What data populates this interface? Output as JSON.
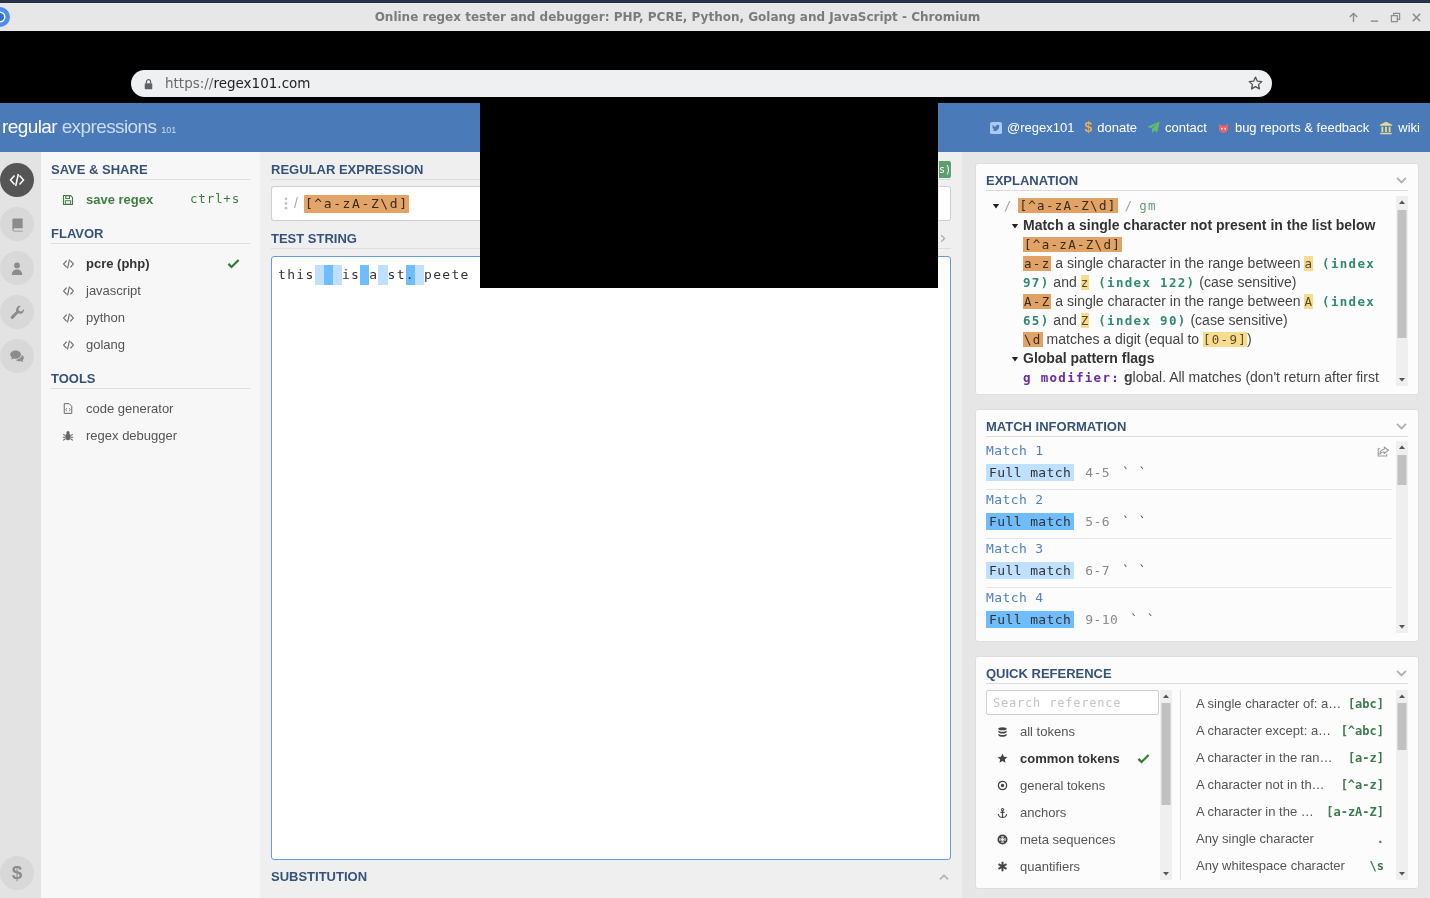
{
  "browser": {
    "title": "Online regex tester and debugger: PHP, PCRE, Python, Golang and JavaScript - Chromium",
    "address": {
      "scheme": "https://",
      "host": "regex101.com"
    }
  },
  "header": {
    "logo": {
      "main": "regular",
      "secondary": "expressions",
      "version": "101"
    },
    "links": [
      {
        "kind": "social",
        "label": "@regex101"
      },
      {
        "kind": "donate",
        "symbol": "$",
        "label": "donate"
      },
      {
        "kind": "contact",
        "label": "contact"
      },
      {
        "kind": "issues",
        "label": "bug reports & feedback"
      },
      {
        "kind": "wiki",
        "label": "wiki"
      }
    ]
  },
  "rail": {
    "items": [
      {
        "selected": true
      },
      {
        "selected": false
      },
      {
        "selected": false
      },
      {
        "selected": false
      },
      {
        "selected": false
      }
    ],
    "donate_symbol": "$"
  },
  "sidebar": {
    "sections": [
      {
        "title": "SAVE & SHARE",
        "items": [
          {
            "kind": "save",
            "label": "save regex",
            "shortcut": "ctrl+s"
          }
        ]
      },
      {
        "title": "FLAVOR",
        "items": [
          {
            "kind": "flavor",
            "label": "pcre (php)",
            "selected": true
          },
          {
            "kind": "flavor",
            "label": "javascript",
            "selected": false
          },
          {
            "kind": "flavor",
            "label": "python",
            "selected": false
          },
          {
            "kind": "flavor",
            "label": "golang",
            "selected": false
          }
        ]
      },
      {
        "title": "TOOLS",
        "items": [
          {
            "kind": "generator",
            "label": "code generator"
          },
          {
            "kind": "debugger",
            "label": "regex debugger"
          }
        ]
      }
    ]
  },
  "editor": {
    "regex_title": "REGULAR EXPRESSION",
    "match_badge": "s)",
    "regex": {
      "delimiter": "/",
      "pattern": "[^a-zA-Z\\d]"
    },
    "test_title": "TEST STRING",
    "test_string": [
      {
        "kind": "text",
        "text": "this"
      },
      {
        "kind": "match",
        "color": "#c0e0ff"
      },
      {
        "kind": "match",
        "color": "#6fbdfc"
      },
      {
        "kind": "match",
        "color": "#c0e0ff"
      },
      {
        "kind": "text",
        "text": "is"
      },
      {
        "kind": "match",
        "color": "#6fbdfc"
      },
      {
        "kind": "text",
        "text": "a"
      },
      {
        "kind": "match",
        "color": "#c0e0ff"
      },
      {
        "kind": "text",
        "text": "st"
      },
      {
        "kind": "match",
        "text": ".",
        "color": "#6fbdfc"
      },
      {
        "kind": "match",
        "color": "#c0e0ff"
      },
      {
        "kind": "text",
        "text": "peete"
      }
    ],
    "substitution_title": "SUBSTITUTION"
  },
  "explanation": {
    "title": "EXPLANATION",
    "tree": [
      {
        "expanded": true,
        "parts": [
          {
            "kind": "delimiter",
            "text": "/ "
          },
          {
            "kind": "token",
            "text": "[^a-zA-Z\\d]"
          },
          {
            "kind": "delimiter",
            "text": " / "
          },
          {
            "kind": "flags",
            "text": "gm"
          }
        ],
        "children": [
          {
            "expanded": true,
            "parts": [
              {
                "kind": "heading",
                "text": "Match a single character not present in the list below"
              }
            ],
            "children": [
              {
                "parts": [
                  {
                    "kind": "token",
                    "text": "[^a-zA-Z\\d]"
                  }
                ]
              },
              {
                "parts": [
                  {
                    "kind": "token",
                    "text": "a-z"
                  },
                  {
                    "kind": "text",
                    "text": " a single character in the range between "
                  },
                  {
                    "kind": "char",
                    "text": "a"
                  },
                  {
                    "kind": "index",
                    "text": " (index 97)"
                  },
                  {
                    "kind": "text",
                    "text": " and "
                  },
                  {
                    "kind": "char",
                    "text": "z"
                  },
                  {
                    "kind": "index",
                    "text": " (index 122)"
                  },
                  {
                    "kind": "text",
                    "text": " (case sensitive)"
                  }
                ]
              },
              {
                "parts": [
                  {
                    "kind": "token",
                    "text": "A-Z"
                  },
                  {
                    "kind": "text",
                    "text": " a single character in the range between "
                  },
                  {
                    "kind": "char",
                    "text": "A"
                  },
                  {
                    "kind": "index",
                    "text": " (index 65)"
                  },
                  {
                    "kind": "text",
                    "text": " and "
                  },
                  {
                    "kind": "char",
                    "text": "Z"
                  },
                  {
                    "kind": "index",
                    "text": " (index 90)"
                  },
                  {
                    "kind": "text",
                    "text": " (case sensitive)"
                  }
                ]
              },
              {
                "parts": [
                  {
                    "kind": "token",
                    "text": "\\d"
                  },
                  {
                    "kind": "text",
                    "text": " matches a digit (equal to "
                  },
                  {
                    "kind": "char",
                    "text": "[0-9]"
                  },
                  {
                    "kind": "text",
                    "text": ")"
                  }
                ]
              }
            ]
          },
          {
            "expanded": true,
            "parts": [
              {
                "kind": "heading",
                "text": "Global pattern flags"
              }
            ],
            "children": [
              {
                "parts": [
                  {
                    "kind": "flag",
                    "text": "g modifier:"
                  },
                  {
                    "kind": "text",
                    "text": " **g**lobal. All matches (don't return after first"
                  }
                ]
              }
            ]
          }
        ]
      }
    ]
  },
  "match_information": {
    "title": "MATCH INFORMATION",
    "matches": [
      {
        "title": "Match 1",
        "group": "Full match",
        "range": "4-5",
        "value": "` `",
        "color": "#c0e0ff"
      },
      {
        "title": "Match 2",
        "group": "Full match",
        "range": "5-6",
        "value": "` `",
        "color": "#6fbdfc"
      },
      {
        "title": "Match 3",
        "group": "Full match",
        "range": "6-7",
        "value": "` `",
        "color": "#c0e0ff"
      },
      {
        "title": "Match 4",
        "group": "Full match",
        "range": "9-10",
        "value": "` `",
        "color": "#6fbdfc"
      }
    ]
  },
  "quick_reference": {
    "title": "QUICK REFERENCE",
    "search": {
      "placeholder": "Search reference"
    },
    "categories": [
      {
        "label": "all tokens",
        "selected": false
      },
      {
        "label": "common tokens",
        "selected": true
      },
      {
        "label": "general tokens",
        "selected": false
      },
      {
        "label": "anchors",
        "selected": false
      },
      {
        "label": "meta sequences",
        "selected": false
      },
      {
        "label": "quantifiers",
        "selected": false
      }
    ],
    "items": [
      {
        "description": "A single character of: a…",
        "token": "[abc]"
      },
      {
        "description": "A character except: a…",
        "token": "[^abc]"
      },
      {
        "description": "A character in the ran…",
        "token": "[a-z]"
      },
      {
        "description": "A character not in th…",
        "token": "[^a-z]"
      },
      {
        "description": "A character in the …",
        "token": "[a-zA-Z]"
      },
      {
        "description": "Any single character",
        "token": "."
      },
      {
        "description": "Any whitespace character",
        "token": "\\s"
      }
    ]
  }
}
